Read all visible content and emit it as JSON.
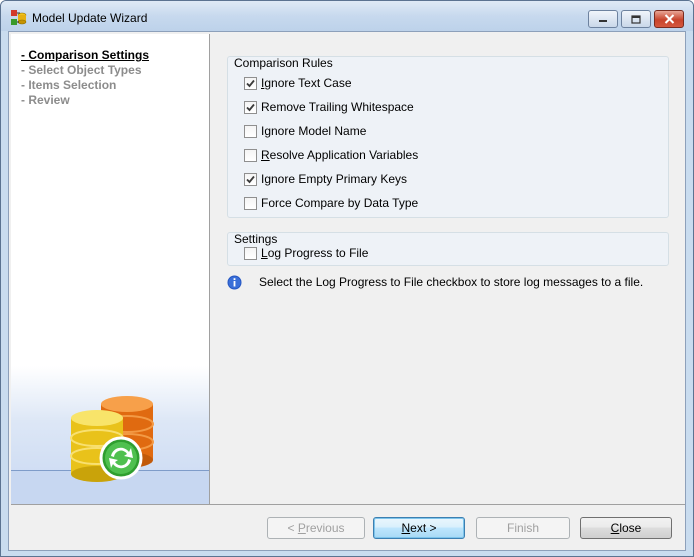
{
  "window": {
    "title": "Model Update Wizard"
  },
  "nav": {
    "items": [
      {
        "label": "- Comparison Settings",
        "active": true
      },
      {
        "label": "- Select Object Types",
        "active": false
      },
      {
        "label": "- Items Selection",
        "active": false
      },
      {
        "label": "- Review",
        "active": false
      }
    ]
  },
  "rules": {
    "group_label": "Comparison Rules",
    "items": [
      {
        "label": "Ignore Text Case",
        "checked": true,
        "mnemonic": "I",
        "rest": "gnore Text Case"
      },
      {
        "label": "Remove Trailing Whitespace",
        "checked": true,
        "mnemonic": "",
        "rest": "Remove Trailing Whitespace"
      },
      {
        "label": "Ignore Model Name",
        "checked": false,
        "mnemonic": "",
        "rest": "Ignore Model Name"
      },
      {
        "label": "Resolve Application Variables",
        "checked": false,
        "mnemonic": "R",
        "rest": "esolve Application Variables"
      },
      {
        "label": "Ignore Empty Primary Keys",
        "checked": true,
        "mnemonic": "",
        "rest": "Ignore Empty Primary Keys"
      },
      {
        "label": "Force Compare by Data Type",
        "checked": false,
        "mnemonic": "",
        "rest": "Force Compare by Data Type"
      }
    ]
  },
  "settings": {
    "group_label": "Settings",
    "log_progress": {
      "label": "Log Progress to File",
      "checked": false,
      "mnemonic": "L",
      "rest": "og Progress to File"
    }
  },
  "info": {
    "icon": "info-icon",
    "text": "Select the Log Progress to File checkbox to store log messages to a file."
  },
  "buttons": {
    "previous": {
      "mnemonic": "P",
      "prefix": "< ",
      "rest": "revious",
      "enabled": false
    },
    "next": {
      "mnemonic": "N",
      "prefix": "",
      "rest": "ext >",
      "enabled": true
    },
    "finish": {
      "label": "Finish",
      "enabled": false
    },
    "close": {
      "mnemonic": "C",
      "prefix": "",
      "rest": "lose",
      "enabled": true
    }
  },
  "colors": {
    "accent": "#3c7fb1",
    "info_blue": "#1f4fb4"
  }
}
